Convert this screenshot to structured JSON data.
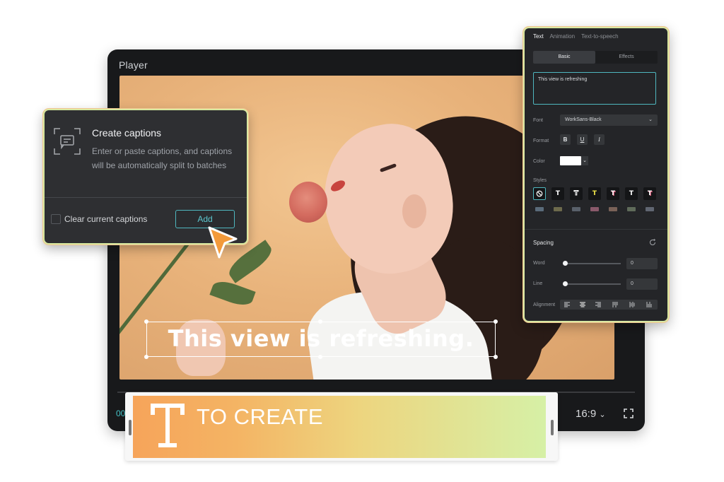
{
  "player": {
    "title": "Player",
    "caption_text": "This view is refreshing.",
    "time_current": "00",
    "aspect_ratio": "16:9"
  },
  "captions_popup": {
    "title": "Create captions",
    "description": "Enter or paste captions, and captions will be automatically split to batches",
    "checkbox_label": "Clear current captions",
    "add_button": "Add"
  },
  "text_panel": {
    "tabs": [
      "Text",
      "Animation",
      "Text-to-speech"
    ],
    "subtabs": [
      "Basic",
      "Effects"
    ],
    "text_value": "This view is refreshing",
    "font_label": "Font",
    "font_value": "WorkSans-Black",
    "format_label": "Format",
    "format_buttons": [
      "B",
      "U",
      "I"
    ],
    "color_label": "Color",
    "color_value": "#ffffff",
    "styles_label": "Styles",
    "spacing_title": "Spacing",
    "word_label": "Word",
    "word_value": "0",
    "line_label": "Line",
    "line_value": "0",
    "alignment_label": "Alignment"
  },
  "banner": {
    "text": "TO CREATE"
  },
  "colors": {
    "accent": "#4fb7bf",
    "cursor": "#f39a3a"
  }
}
